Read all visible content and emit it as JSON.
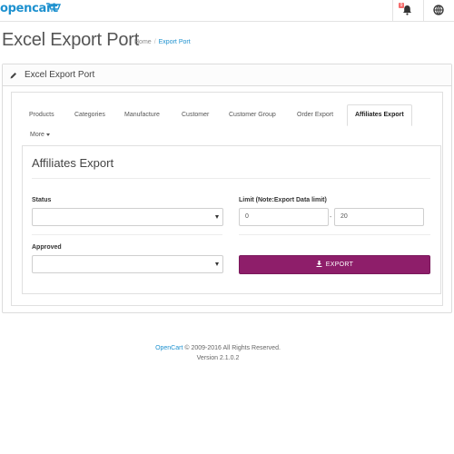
{
  "header": {
    "logo_text": "opencart",
    "notification_count": "9"
  },
  "page": {
    "title": "Excel Export Port",
    "breadcrumb": [
      {
        "label": "Home"
      },
      {
        "label": "Export Port"
      }
    ]
  },
  "panel": {
    "title": "Excel Export Port"
  },
  "tabs": [
    {
      "label": "Products"
    },
    {
      "label": "Categories"
    },
    {
      "label": "Manufacture"
    },
    {
      "label": "Customer"
    },
    {
      "label": "Customer Group"
    },
    {
      "label": "Order Export"
    },
    {
      "label": "Affiliates Export",
      "active": true
    }
  ],
  "more_label": "More",
  "form": {
    "section_title": "Affiliates Export",
    "status_label": "Status",
    "status_value": "",
    "limit_label": "Limit (Note:Export Data limit)",
    "limit_start": "0",
    "limit_separator": "-",
    "limit_end": "20",
    "approved_label": "Approved",
    "approved_value": "",
    "export_label": "EXPORT"
  },
  "footer": {
    "link": "OpenCart",
    "copyright": " © 2009-2016 All Rights Reserved.",
    "version": "Version 2.1.0.2"
  },
  "colors": {
    "brand": "#1e91cf",
    "export_button": "#8e1e6a"
  },
  "icons": {
    "header": [
      "bell-icon",
      "globe-icon"
    ],
    "panel": "pencil-icon",
    "button": "download-icon"
  }
}
